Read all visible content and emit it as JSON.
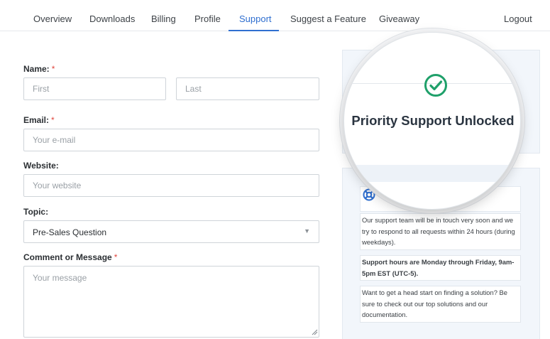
{
  "nav": {
    "items": [
      {
        "label": "Overview",
        "active": false
      },
      {
        "label": "Downloads",
        "active": false
      },
      {
        "label": "Billing",
        "active": false
      },
      {
        "label": "Profile",
        "active": false
      },
      {
        "label": "Support",
        "active": true
      },
      {
        "label": "Suggest a Feature",
        "active": false
      },
      {
        "label": "Giveaway",
        "active": false
      }
    ],
    "logout": "Logout"
  },
  "form": {
    "name_label": "Name:",
    "required_mark": "*",
    "first_placeholder": "First",
    "last_placeholder": "Last",
    "email_label": "Email:",
    "email_placeholder": "Your e-mail",
    "website_label": "Website:",
    "website_placeholder": "Your website",
    "topic_label": "Topic:",
    "topic_selected": "Pre-Sales Question",
    "message_label": "Comment or Message",
    "message_placeholder": "Your message"
  },
  "support_panel": {
    "title": "Priority Support Unlocked",
    "check_icon": "check-circle-icon",
    "help_icon": "lifebuoy-icon",
    "info_1": "Our support team will be in touch very soon and we try to respond to all requests within 24 hours (during weekdays).",
    "info_2": "Support hours are Monday through Friday, 9am-5pm EST (UTC-5).",
    "info_3": "Want to get a head start on finding a solution? Be sure to check out our top solutions and our documentation."
  },
  "colors": {
    "accent": "#2f6fd0",
    "required": "#e0473e",
    "success": "#1fa06a"
  }
}
